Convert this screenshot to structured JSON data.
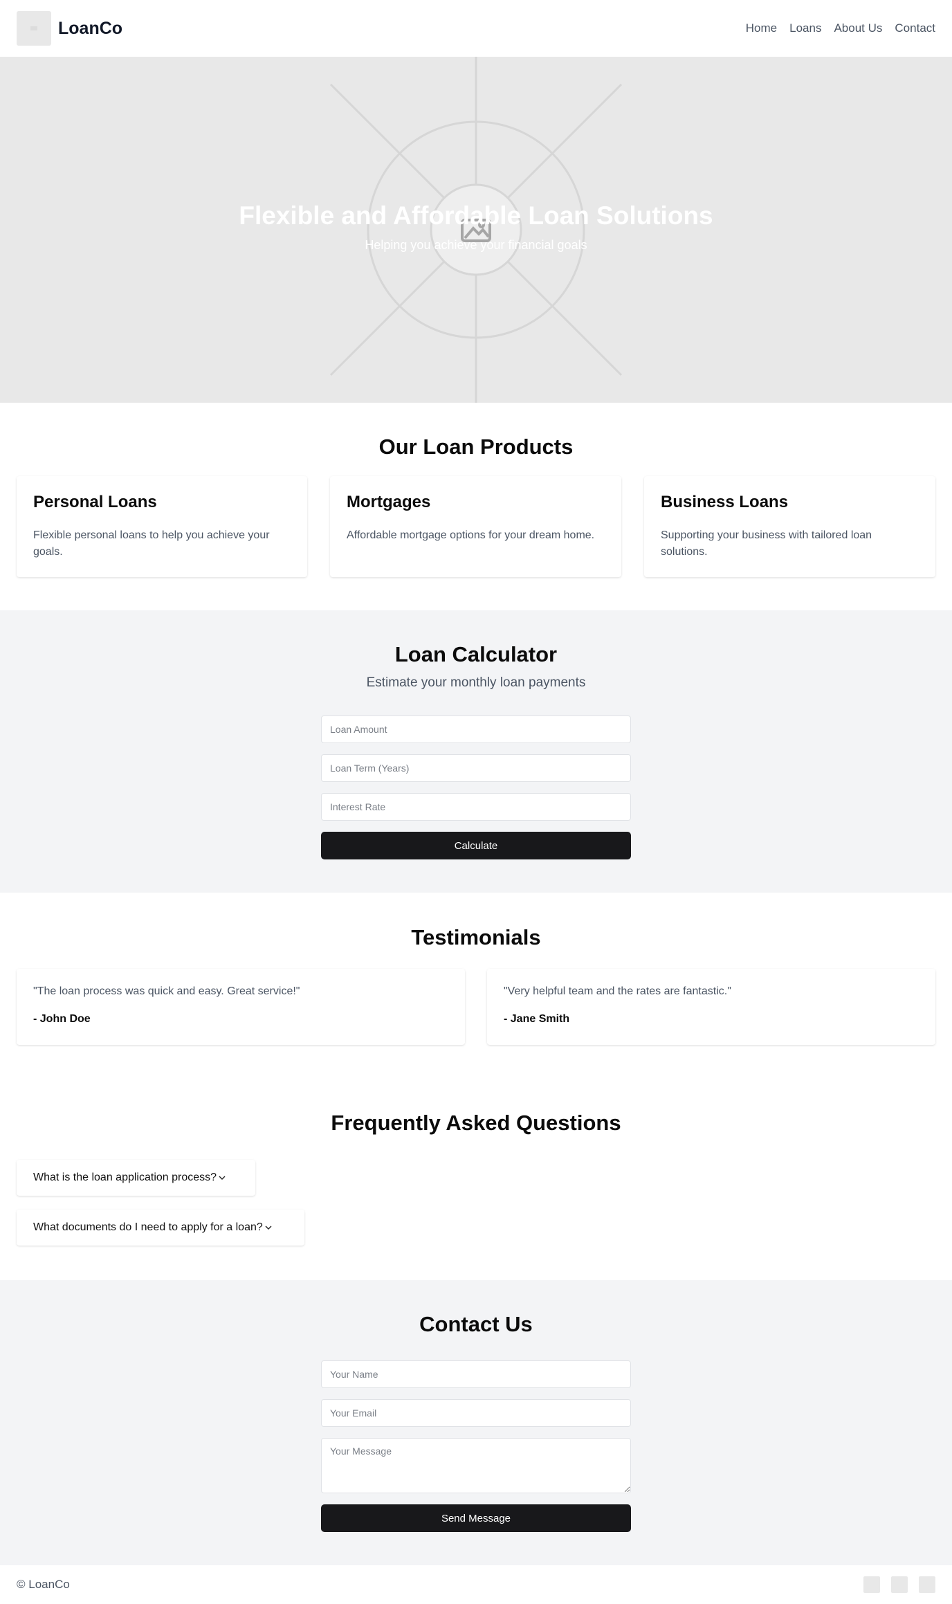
{
  "header": {
    "brand": "LoanCo",
    "nav": [
      "Home",
      "Loans",
      "About Us",
      "Contact"
    ]
  },
  "hero": {
    "title": "Flexible and Affordable Loan Solutions",
    "subtitle": "Helping you achieve your financial goals"
  },
  "products": {
    "title": "Our Loan Products",
    "items": [
      {
        "title": "Personal Loans",
        "text": "Flexible personal loans to help you achieve your goals."
      },
      {
        "title": "Mortgages",
        "text": "Affordable mortgage options for your dream home."
      },
      {
        "title": "Business Loans",
        "text": "Supporting your business with tailored loan solutions."
      }
    ]
  },
  "calculator": {
    "title": "Loan Calculator",
    "subtitle": "Estimate your monthly loan payments",
    "amount_placeholder": "Loan Amount",
    "term_placeholder": "Loan Term (Years)",
    "rate_placeholder": "Interest Rate",
    "button": "Calculate"
  },
  "testimonials": {
    "title": "Testimonials",
    "items": [
      {
        "quote": "\"The loan process was quick and easy. Great service!\"",
        "author": "- John Doe"
      },
      {
        "quote": "\"Very helpful team and the rates are fantastic.\"",
        "author": "- Jane Smith"
      }
    ]
  },
  "faq": {
    "title": "Frequently Asked Questions",
    "items": [
      {
        "question": "What is the loan application process?"
      },
      {
        "question": "What documents do I need to apply for a loan?"
      }
    ]
  },
  "contact": {
    "title": "Contact Us",
    "name_placeholder": "Your Name",
    "email_placeholder": "Your Email",
    "message_placeholder": "Your Message",
    "button": "Send Message"
  },
  "footer": {
    "copyright": "© LoanCo",
    "social_icons": [
      "social-icon",
      "social-icon",
      "social-icon"
    ]
  },
  "colors": {
    "accent_dark": "#18181b",
    "muted_text": "#4b5563",
    "placeholder_bg": "#e8e8e8",
    "band_bg": "#f3f4f6"
  }
}
